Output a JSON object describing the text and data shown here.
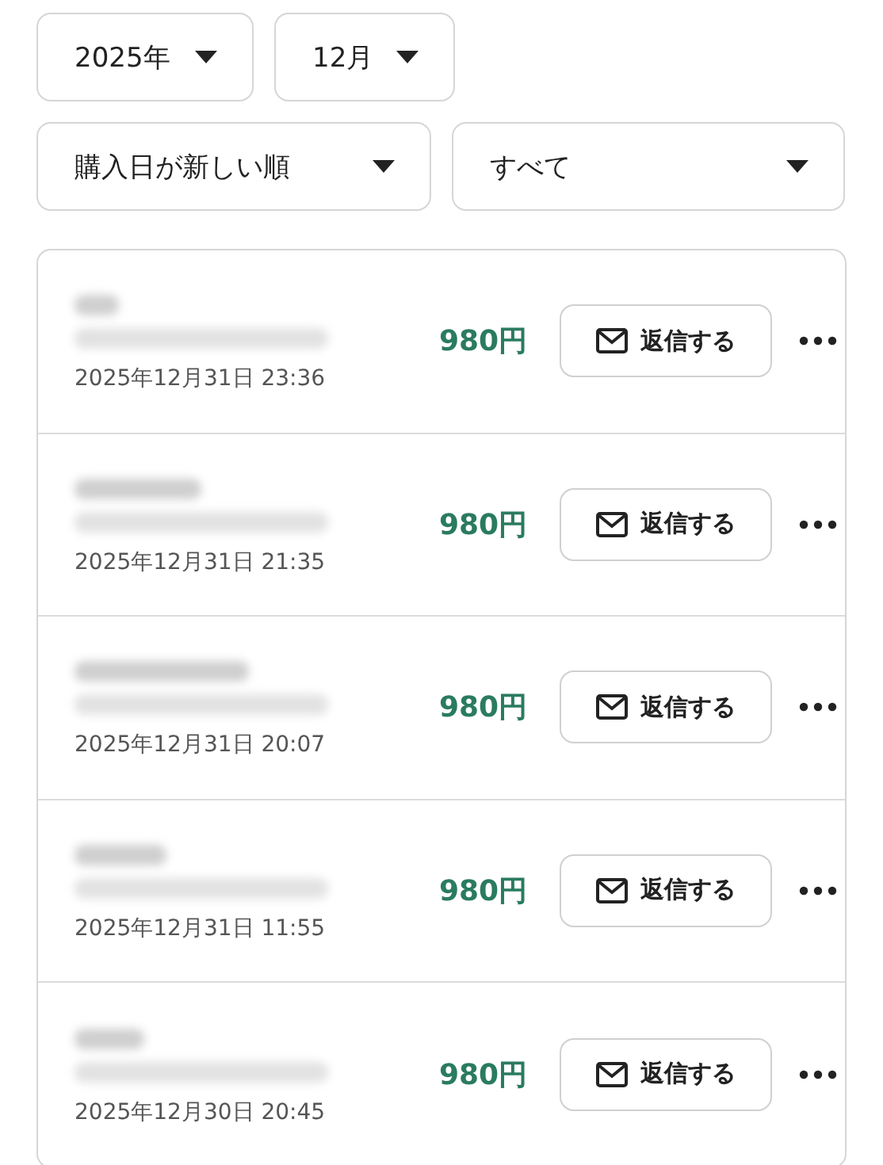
{
  "filters": [
    {
      "value": "2025年"
    },
    {
      "value": "12月"
    },
    {
      "value": "購入日が新しい順"
    },
    {
      "value": "すべて"
    }
  ],
  "orders": [
    {
      "price": "980円",
      "date": "2025年12月31日 23:36",
      "reply_button": "返信する"
    },
    {
      "price": "980円",
      "date": "2025年12月31日 21:35",
      "reply_button": "返信する"
    },
    {
      "price": "980円",
      "date": "2025年12月31日 20:07",
      "reply_button": "返信する"
    },
    {
      "price": "980円",
      "date": "2025年12月31日 11:55",
      "reply_button": "返信する"
    },
    {
      "price": "980円",
      "date": "2025年12月30日 20:45",
      "reply_button": "返信する"
    }
  ]
}
